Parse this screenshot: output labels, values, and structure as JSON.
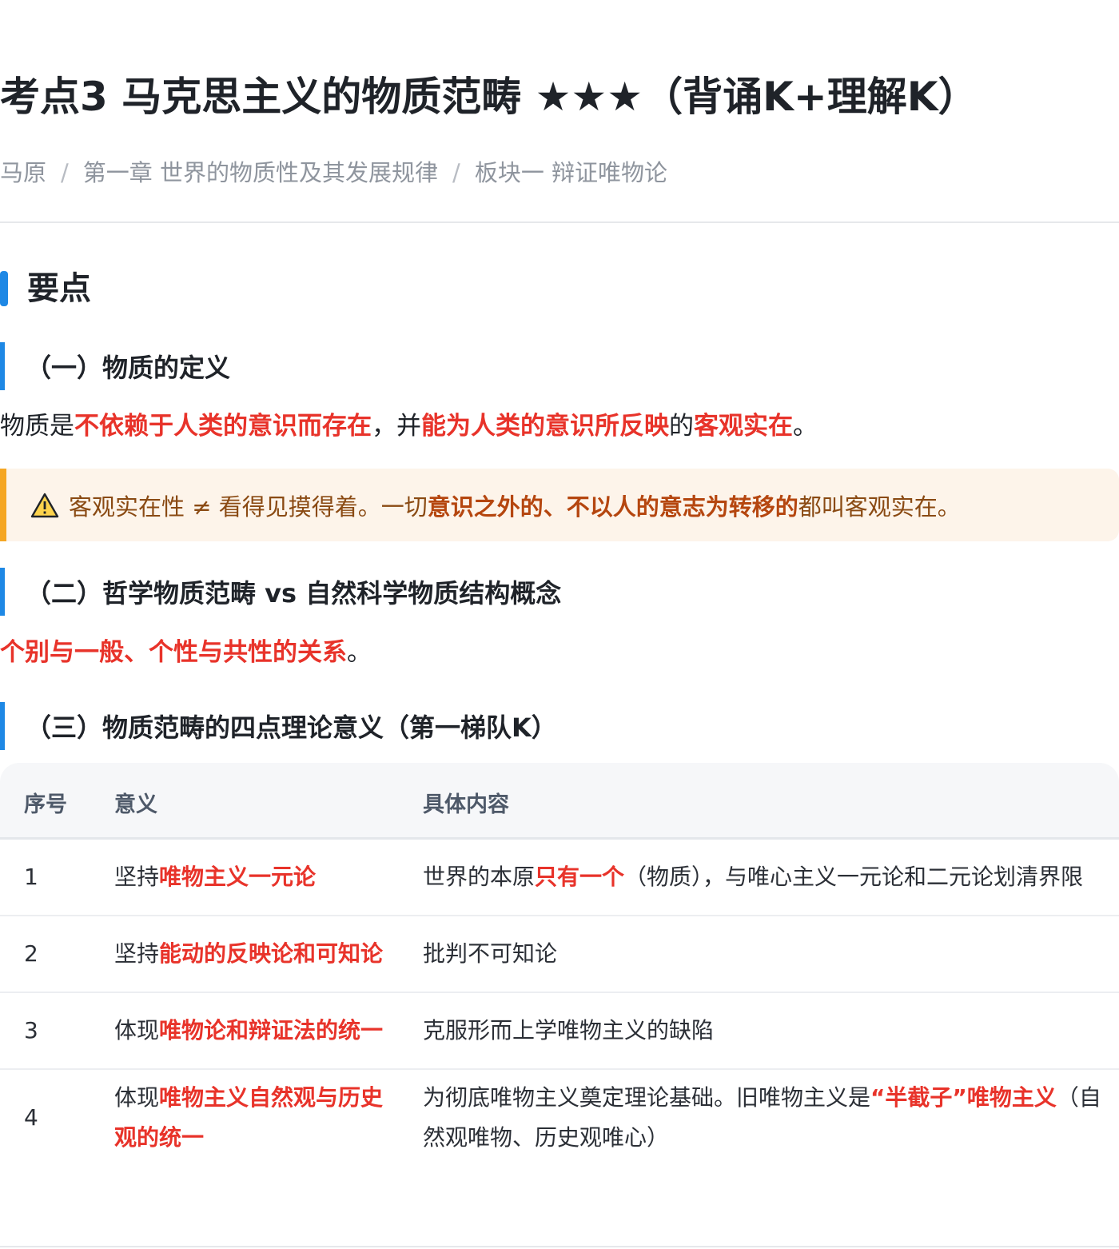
{
  "header": {
    "title": "考点3 马克思主义的物质范畴 ★★★（背诵K+理解K）",
    "breadcrumb": [
      "马原",
      "第一章 世界的物质性及其发展规律",
      "板块一 辩证唯物论"
    ]
  },
  "section": {
    "title": "要点"
  },
  "sub1": {
    "title": "（一）物质的定义",
    "para": [
      {
        "text": "物质是",
        "style": "normal"
      },
      {
        "text": "不依赖于人类的意识而存在",
        "style": "red"
      },
      {
        "text": "，并",
        "style": "normal"
      },
      {
        "text": "能为人类的意识所反映",
        "style": "red"
      },
      {
        "text": "的",
        "style": "normal"
      },
      {
        "text": "客观实在",
        "style": "red"
      },
      {
        "text": "。",
        "style": "normal"
      }
    ],
    "callout": {
      "icon": "warning-icon",
      "text_before": "客观实在性 ≠ 看得见摸得着。一切",
      "highlight": "意识之外的、不以人的意志为转移的",
      "text_after": "都叫客观实在。"
    }
  },
  "sub2": {
    "title": "（二）哲学物质范畴 vs 自然科学物质结构概念",
    "para_red": "个别与一般、个性与共性的关系",
    "para_end": "。"
  },
  "sub3": {
    "title": "（三）物质范畴的四点理论意义（第一梯队K）"
  },
  "table": {
    "headers": [
      "序号",
      "意义",
      "具体内容"
    ],
    "rows": [
      {
        "no": "1",
        "meaning_prefix": "坚持",
        "meaning_red": "唯物主义一元论",
        "content": [
          {
            "text": "世界的本原",
            "style": "normal"
          },
          {
            "text": "只有一个",
            "style": "red"
          },
          {
            "text": "（物质），与唯心主义一元论和二元论划清界限",
            "style": "normal"
          }
        ]
      },
      {
        "no": "2",
        "meaning_prefix": "坚持",
        "meaning_red": "能动的反映论和可知论",
        "content": [
          {
            "text": "批判不可知论",
            "style": "normal"
          }
        ]
      },
      {
        "no": "3",
        "meaning_prefix": "体现",
        "meaning_red": "唯物论和辩证法的统一",
        "content": [
          {
            "text": "克服形而上学唯物主义的缺陷",
            "style": "normal"
          }
        ]
      },
      {
        "no": "4",
        "meaning_prefix": "体现",
        "meaning_red": "唯物主义自然观与历史观的统一",
        "content": [
          {
            "text": "为彻底唯物主义奠定理论基础。旧唯物主义是",
            "style": "normal"
          },
          {
            "text": "“半截子”唯物主义",
            "style": "red"
          },
          {
            "text": "（自然观唯物、历史观唯心）",
            "style": "normal"
          }
        ]
      }
    ]
  },
  "colors": {
    "accent": "#1e88e5",
    "red": "#e8332a",
    "callout_bg": "#fdf4ea",
    "callout_border": "#f5a623"
  }
}
